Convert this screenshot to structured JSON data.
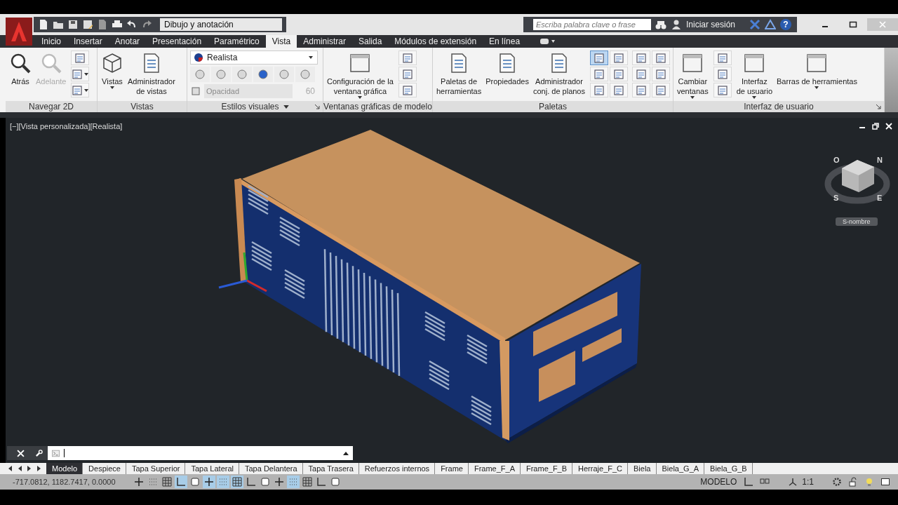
{
  "app": {
    "workspace": "Dibujo y anotación",
    "search_placeholder": "Escriba palabra clave o frase",
    "sign_in": "Iniciar sesión",
    "help": "?"
  },
  "ribbon_tabs": [
    {
      "label": "Inicio",
      "selected": false
    },
    {
      "label": "Insertar",
      "selected": false
    },
    {
      "label": "Anotar",
      "selected": false
    },
    {
      "label": "Presentación",
      "selected": false
    },
    {
      "label": "Paramétrico",
      "selected": false
    },
    {
      "label": "Vista",
      "selected": true
    },
    {
      "label": "Administrar",
      "selected": false
    },
    {
      "label": "Salida",
      "selected": false
    },
    {
      "label": "Módulos de extensión",
      "selected": false
    },
    {
      "label": "En línea",
      "selected": false
    }
  ],
  "panels": [
    {
      "title": "Navegar 2D",
      "menu": false,
      "launcher": false,
      "groups": [
        {
          "kind": "large",
          "buttons": [
            {
              "label": "Atrás",
              "disabled": false,
              "dropdown": false
            },
            {
              "label": "Adelante",
              "disabled": true,
              "dropdown": false
            }
          ]
        },
        {
          "kind": "small",
          "tools": [
            {
              "on": false,
              "dropdown": false
            },
            {
              "on": false,
              "dropdown": true
            },
            {
              "on": false,
              "dropdown": true
            }
          ]
        }
      ]
    },
    {
      "title": "Vistas",
      "menu": false,
      "launcher": false,
      "groups": [
        {
          "kind": "large",
          "buttons": [
            {
              "label": "Vistas",
              "disabled": false,
              "dropdown": true
            },
            {
              "label": "Administrador\nde vistas",
              "disabled": false,
              "dropdown": false
            }
          ]
        }
      ]
    },
    {
      "title": "Estilos visuales",
      "menu": true,
      "launcher": true,
      "groups": [
        {
          "kind": "styles",
          "style": "Realista",
          "opacity_placeholder": "Opacidad",
          "opacity_disabled": true,
          "opacity": "60"
        }
      ]
    },
    {
      "title": "Ventanas gráficas de modelo",
      "menu": false,
      "launcher": false,
      "groups": [
        {
          "kind": "large",
          "buttons": [
            {
              "label": "Configuración de la\nventana gráfica",
              "disabled": false,
              "dropdown": true
            }
          ]
        },
        {
          "kind": "small",
          "tools": [
            {
              "on": false,
              "dropdown": false
            },
            {
              "on": false,
              "dropdown": false
            },
            {
              "on": false,
              "dropdown": false
            }
          ]
        }
      ]
    },
    {
      "title": "Paletas",
      "menu": false,
      "launcher": false,
      "groups": [
        {
          "kind": "large",
          "buttons": [
            {
              "label": "Paletas de\nherramientas",
              "disabled": false,
              "dropdown": false
            },
            {
              "label": "Propiedades",
              "disabled": false,
              "dropdown": false
            },
            {
              "label": "Administrador\nconj. de planos",
              "disabled": false,
              "dropdown": false
            }
          ]
        },
        {
          "kind": "small",
          "tools": [
            {
              "on": true,
              "dropdown": false
            },
            {
              "on": false,
              "dropdown": false
            },
            {
              "on": false,
              "dropdown": false
            },
            {
              "on": false,
              "dropdown": false
            },
            {
              "on": false,
              "dropdown": false
            },
            {
              "on": false,
              "dropdown": false
            }
          ]
        },
        {
          "kind": "small",
          "tools": [
            {
              "on": false,
              "dropdown": false
            },
            {
              "on": false,
              "dropdown": false
            },
            {
              "on": false,
              "dropdown": false
            },
            {
              "on": false,
              "dropdown": false
            },
            {
              "on": false,
              "dropdown": false
            },
            {
              "on": false,
              "dropdown": false
            }
          ]
        }
      ]
    },
    {
      "title": "Interfaz de usuario",
      "menu": false,
      "launcher": true,
      "groups": [
        {
          "kind": "large",
          "buttons": [
            {
              "label": "Cambiar\nventanas",
              "disabled": false,
              "dropdown": true
            }
          ]
        },
        {
          "kind": "small",
          "tools": [
            {
              "on": false,
              "dropdown": false
            },
            {
              "on": false,
              "dropdown": false
            },
            {
              "on": false,
              "dropdown": false
            }
          ]
        },
        {
          "kind": "large",
          "buttons": [
            {
              "label": "Interfaz\nde usuario",
              "disabled": false,
              "dropdown": true
            },
            {
              "label": "Barras de herramientas",
              "disabled": false,
              "dropdown": true
            }
          ]
        }
      ]
    }
  ],
  "viewport": {
    "label": "[−][Vista personalizada][Realista]",
    "compass": [
      "O",
      "N",
      "S",
      "E"
    ],
    "view_name": "S-nombre"
  },
  "layout_tabs": [
    {
      "label": "Modelo",
      "selected": true
    },
    {
      "label": "Despiece",
      "selected": false
    },
    {
      "label": "Tapa Superior",
      "selected": false
    },
    {
      "label": "Tapa Lateral",
      "selected": false
    },
    {
      "label": "Tapa Delantera",
      "selected": false
    },
    {
      "label": "Tapa Trasera",
      "selected": false
    },
    {
      "label": "Refuerzos internos",
      "selected": false
    },
    {
      "label": "Frame",
      "selected": false
    },
    {
      "label": "Frame_F_A",
      "selected": false
    },
    {
      "label": "Frame_F_B",
      "selected": false
    },
    {
      "label": "Herraje_F_C",
      "selected": false
    },
    {
      "label": "Biela",
      "selected": false
    },
    {
      "label": "Biela_G_A",
      "selected": false
    },
    {
      "label": "Biela_G_B",
      "selected": false
    }
  ],
  "status_bar": {
    "coordinates": "-717.0812,  1182.7417, 0.0000",
    "toggles": [
      {
        "on": false
      },
      {
        "on": false
      },
      {
        "on": false
      },
      {
        "on": true
      },
      {
        "on": false
      },
      {
        "on": true
      },
      {
        "on": true
      },
      {
        "on": true
      },
      {
        "on": false
      },
      {
        "on": false
      },
      {
        "on": false
      },
      {
        "on": true
      },
      {
        "on": false
      },
      {
        "on": false
      },
      {
        "on": false
      }
    ],
    "space": "MODELO",
    "scale": "1:1"
  }
}
